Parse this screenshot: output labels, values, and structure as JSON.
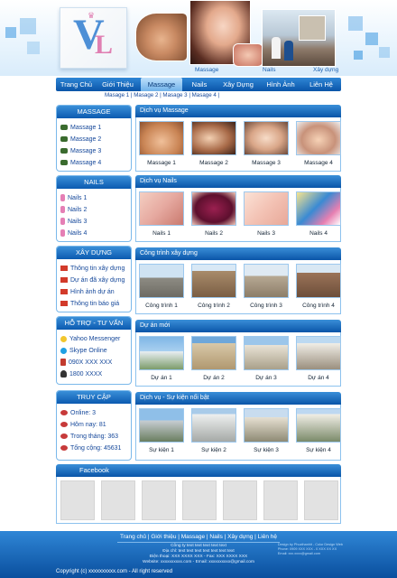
{
  "header": {
    "logo_letters": "VL",
    "banner_labels": [
      "Massage",
      "Nails",
      "Xây dựng"
    ]
  },
  "nav": {
    "items": [
      "Trang Chủ",
      "Giới Thiệu",
      "Massage",
      "Nails",
      "Xây Dựng",
      "Hình Ảnh",
      "Liên Hệ"
    ],
    "active": "Massage",
    "subnav": "Masage 1 | Masage 2 | Masage 3 | Masage 4 |"
  },
  "sidebar": {
    "massage": {
      "title": "MASSAGE",
      "items": [
        "Massage 1",
        "Massage 2",
        "Massage 3",
        "Massage 4"
      ]
    },
    "nails": {
      "title": "NAILS",
      "items": [
        "Nails 1",
        "Nails 2",
        "Nails 3",
        "Nails 4"
      ]
    },
    "xaydung": {
      "title": "XÂY DỰNG",
      "items": [
        "Thông tin xây dựng",
        "Dự án đã xây dựng",
        "Hình ảnh dự án",
        "Thông tin báo giá"
      ]
    },
    "hotro": {
      "title": "HỖ TRỢ - TƯ VẤN",
      "items": [
        "Yahoo Messenger",
        "Skype Online",
        "090X XXX XXX",
        "1800 XXXX"
      ]
    },
    "truycap": {
      "title": "TRUY CẬP",
      "items": [
        "Online: 3",
        "Hôm nay: 81",
        "Trong tháng: 363",
        "Tổng cộng: 45631"
      ]
    }
  },
  "sections": {
    "massage": {
      "title": "Dịch vụ Massage",
      "captions": [
        "Massage 1",
        "Massage 2",
        "Massage 3",
        "Massage 4"
      ]
    },
    "nails": {
      "title": "Dịch vụ Nails",
      "captions": [
        "Nails 1",
        "Nails 2",
        "Nails 3",
        "Nails 4"
      ]
    },
    "congtrinh": {
      "title": "Công trình xây dựng",
      "captions": [
        "Công trình 1",
        "Công trình 2",
        "Công trình 3",
        "Công trình 4"
      ]
    },
    "duan": {
      "title": "Dự án mới",
      "captions": [
        "Dự án 1",
        "Dự án 2",
        "Dự án 3",
        "Dự án 4"
      ]
    },
    "sukien": {
      "title": "Dịch vụ - Sự kiện nổi bật",
      "captions": [
        "Sự kiện 1",
        "Sự kiện 2",
        "Sự kiện 3",
        "Sự kiện 4"
      ]
    }
  },
  "facebook": {
    "title": "Facebook"
  },
  "footer": {
    "nav": "Trang chủ | Giới thiệu | Massage | Nails | Xây dựng | Liên hệ",
    "company": "Công ty text text text text text",
    "address": "Địa chỉ: text text text text text text text",
    "phone": "Điện thoại: XXX XXXX XXX - Fax: XXX XXXX XXX",
    "website": "Website: xxxxxxxxxx.com - Email: xxxxxxxxxx@gmail.com",
    "right_lines": [
      "Design by Phucthanhit - Color Design Web",
      "Phone: 0909 XXX XXX - 0 XXX XX XX",
      "Email: xxx.xxxx@gmail.com"
    ],
    "copyright": "Copyright (c) xxxxxxxxxx.com - All right reserved"
  }
}
